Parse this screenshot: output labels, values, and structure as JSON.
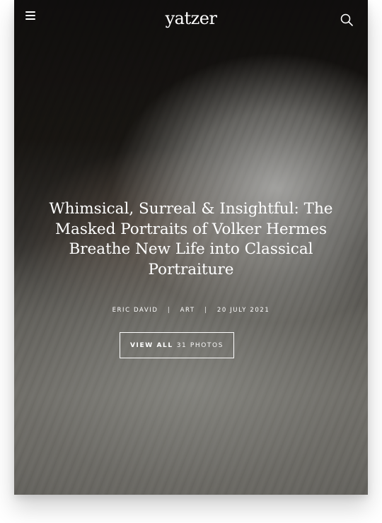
{
  "header": {
    "logo": "yatzer",
    "menu_icon": "hamburger-menu-icon",
    "search_icon": "search-icon"
  },
  "article": {
    "title": "Whimsical, Surreal & Insightful: The Masked Portraits of Volker Hermes Breathe New Life into Classical Portraiture",
    "author": "ERIC DAVID",
    "category": "ART",
    "date": "20 JULY 2021"
  },
  "gallery_button": {
    "label": "VIEW ALL",
    "count_text": "31 PHOTOS"
  },
  "colors": {
    "overlay_text": "#ffffff",
    "page_background": "#ffffff"
  }
}
